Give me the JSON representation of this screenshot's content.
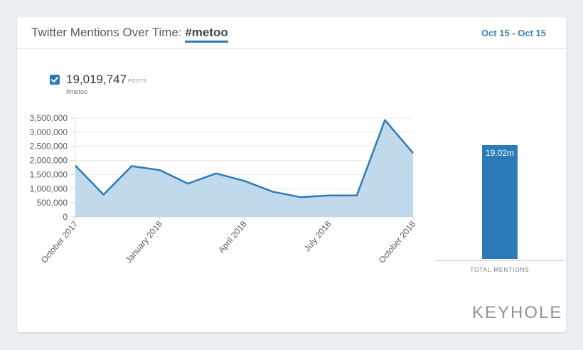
{
  "header": {
    "title_prefix": "Twitter Mentions Over Time: ",
    "hashtag": "#metoo",
    "date_range": "Oct 15 - Oct 15"
  },
  "legend": {
    "count": "19,019,747",
    "unit": "POSTS",
    "tag": "#metoo",
    "checked": true
  },
  "colors": {
    "accent": "#2b7bb9",
    "area_fill": "#b6d3e8",
    "background": "#e9eef2"
  },
  "chart_data": [
    {
      "type": "area",
      "x": [
        "2017-10",
        "2017-11",
        "2017-12",
        "2018-01",
        "2018-02",
        "2018-03",
        "2018-04",
        "2018-05",
        "2018-06",
        "2018-07",
        "2018-08",
        "2018-09",
        "2018-10"
      ],
      "x_tick_labels": [
        "October 2017",
        "January 2018",
        "April 2018",
        "July 2018",
        "October 2018"
      ],
      "series": [
        {
          "values": [
            1820000,
            790000,
            1800000,
            1660000,
            1180000,
            1540000,
            1280000,
            900000,
            700000,
            760000,
            760000,
            3430000,
            2260000
          ]
        }
      ],
      "y_ticks": [
        0,
        500000,
        1000000,
        1500000,
        2000000,
        2500000,
        3000000,
        3500000
      ],
      "y_tick_labels": [
        "0",
        "500,000",
        "1,000,000",
        "1,500,000",
        "2,000,000",
        "2,500,000",
        "3,000,000",
        "3,500,000"
      ],
      "ylim": [
        0,
        3500000
      ],
      "grid": true
    },
    {
      "type": "bar",
      "categories": [
        "TOTAL MENTIONS"
      ],
      "values": [
        19019747
      ],
      "data_labels": [
        "19.02m"
      ]
    }
  ],
  "branding": {
    "logo_text": "KEYHOLE"
  }
}
